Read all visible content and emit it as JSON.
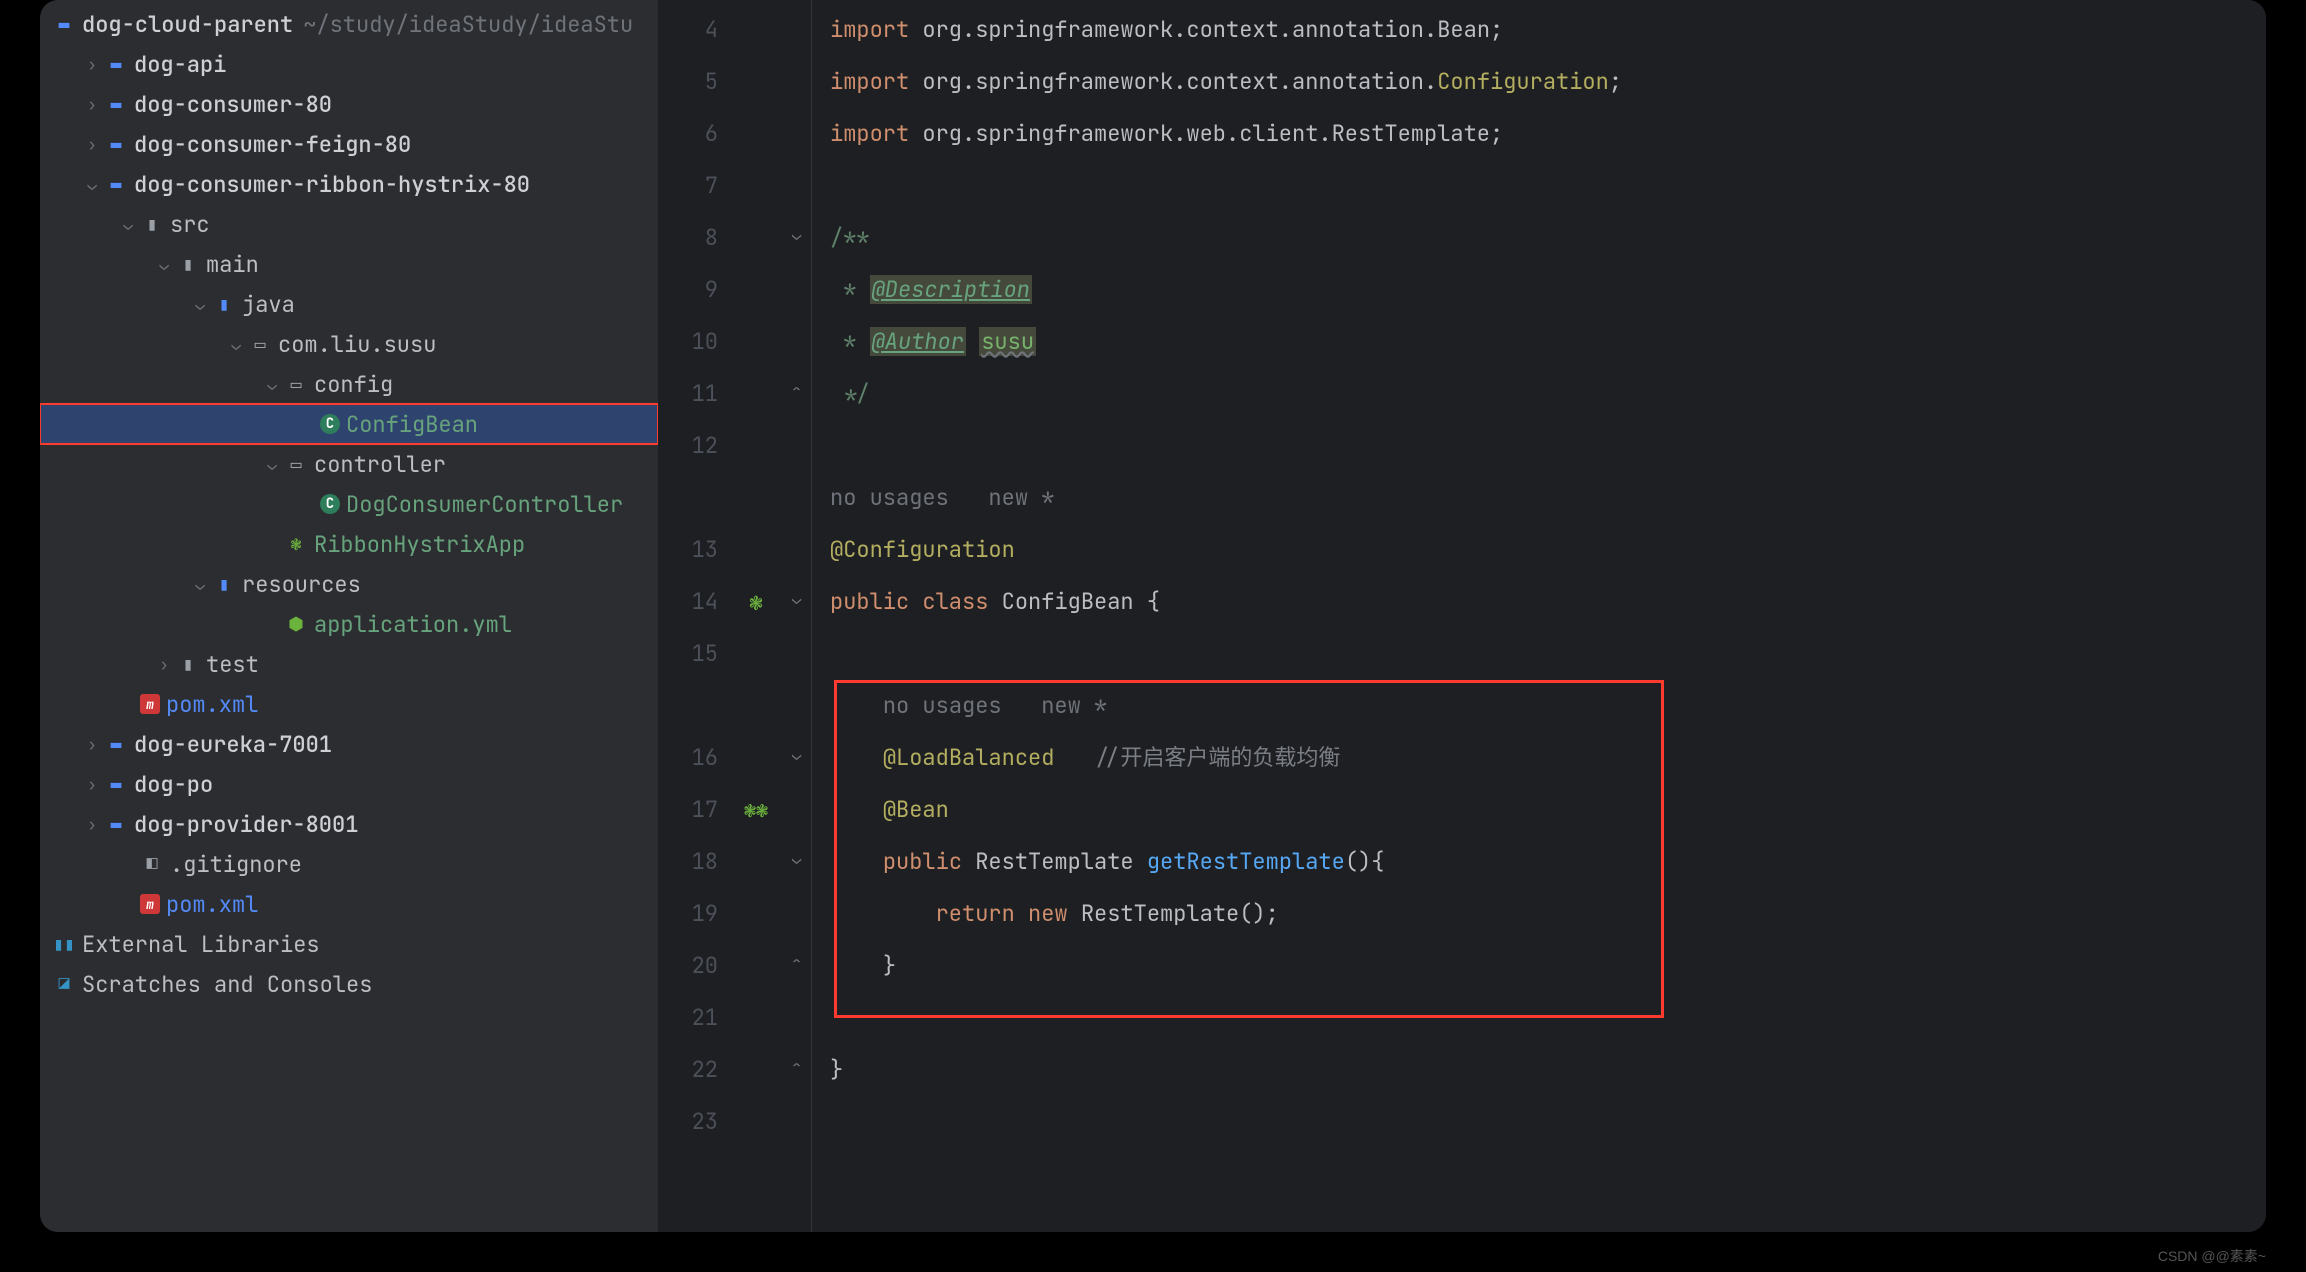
{
  "project": {
    "root": {
      "name": "dog-cloud-parent",
      "path": "~/study/ideaStudy/ideaStu"
    },
    "items": [
      {
        "label": "dog-api",
        "indent": 42,
        "icon": "module",
        "arrow": "right"
      },
      {
        "label": "dog-consumer-80",
        "indent": 42,
        "icon": "module",
        "arrow": "right"
      },
      {
        "label": "dog-consumer-feign-80",
        "indent": 42,
        "icon": "module",
        "arrow": "right"
      },
      {
        "label": "dog-consumer-ribbon-hystrix-80",
        "indent": 42,
        "icon": "module",
        "arrow": "down"
      },
      {
        "label": "src",
        "indent": 78,
        "icon": "folder",
        "arrow": "down"
      },
      {
        "label": "main",
        "indent": 114,
        "icon": "folder",
        "arrow": "down"
      },
      {
        "label": "java",
        "indent": 150,
        "icon": "folder-src",
        "arrow": "down"
      },
      {
        "label": "com.liu.susu",
        "indent": 186,
        "icon": "pkg",
        "arrow": "down"
      },
      {
        "label": "config",
        "indent": 222,
        "icon": "pkg",
        "arrow": "down"
      },
      {
        "label": "ConfigBean",
        "indent": 258,
        "icon": "class",
        "arrow": "none",
        "green": true,
        "selected": true,
        "hl": true
      },
      {
        "label": "controller",
        "indent": 222,
        "icon": "pkg",
        "arrow": "down"
      },
      {
        "label": "DogConsumerController",
        "indent": 258,
        "icon": "class",
        "arrow": "none",
        "green": true
      },
      {
        "label": "RibbonHystrixApp",
        "indent": 222,
        "icon": "spring",
        "arrow": "none",
        "green": true
      },
      {
        "label": "resources",
        "indent": 150,
        "icon": "folder-res",
        "arrow": "down"
      },
      {
        "label": "application.yml",
        "indent": 222,
        "icon": "yml",
        "arrow": "none",
        "green": true
      },
      {
        "label": "test",
        "indent": 114,
        "icon": "folder",
        "arrow": "right"
      },
      {
        "label": "pom.xml",
        "indent": 78,
        "icon": "maven",
        "arrow": "none",
        "blue": true
      },
      {
        "label": "dog-eureka-7001",
        "indent": 42,
        "icon": "module",
        "arrow": "right"
      },
      {
        "label": "dog-po",
        "indent": 42,
        "icon": "module",
        "arrow": "right"
      },
      {
        "label": "dog-provider-8001",
        "indent": 42,
        "icon": "module",
        "arrow": "right"
      },
      {
        "label": ".gitignore",
        "indent": 78,
        "icon": "git",
        "arrow": "none"
      },
      {
        "label": "pom.xml",
        "indent": 78,
        "icon": "maven",
        "arrow": "none",
        "blue": true
      }
    ],
    "external": "External Libraries",
    "scratch": "Scratches and Consoles"
  },
  "editor": {
    "lines": [
      4,
      5,
      6,
      7,
      8,
      9,
      10,
      11,
      12,
      "",
      13,
      14,
      15,
      "",
      16,
      17,
      18,
      19,
      20,
      21,
      22,
      23
    ],
    "code": {
      "import": "import",
      "pkg1": "org.springframework.context.annotation.",
      "Bean": "Bean",
      "Configuration": "Configuration",
      "pkg2": "org.springframework.web.client.",
      "RestTemplate": "RestTemplate",
      "doc_open": "/**",
      "doc_star": " *",
      "doc_desc_tag": "@Description",
      "doc_auth_tag": "@Author",
      "doc_auth_val": "susu",
      "doc_close": " */",
      "hint_nousages": "no usages",
      "hint_new": "new *",
      "anno_cfg": "@Configuration",
      "public": "public",
      "class": "class",
      "classname": "ConfigBean",
      "anno_lb": "@LoadBalanced",
      "lb_comment": "//开启客户端的负载均衡",
      "anno_bean": "@Bean",
      "rettype": "RestTemplate",
      "method": "getRestTemplate",
      "return": "return",
      "new": "new",
      "brace_o": "{",
      "brace_c": "}",
      "paren": "()",
      "semi": ";"
    }
  },
  "watermark": "CSDN @@素素~"
}
